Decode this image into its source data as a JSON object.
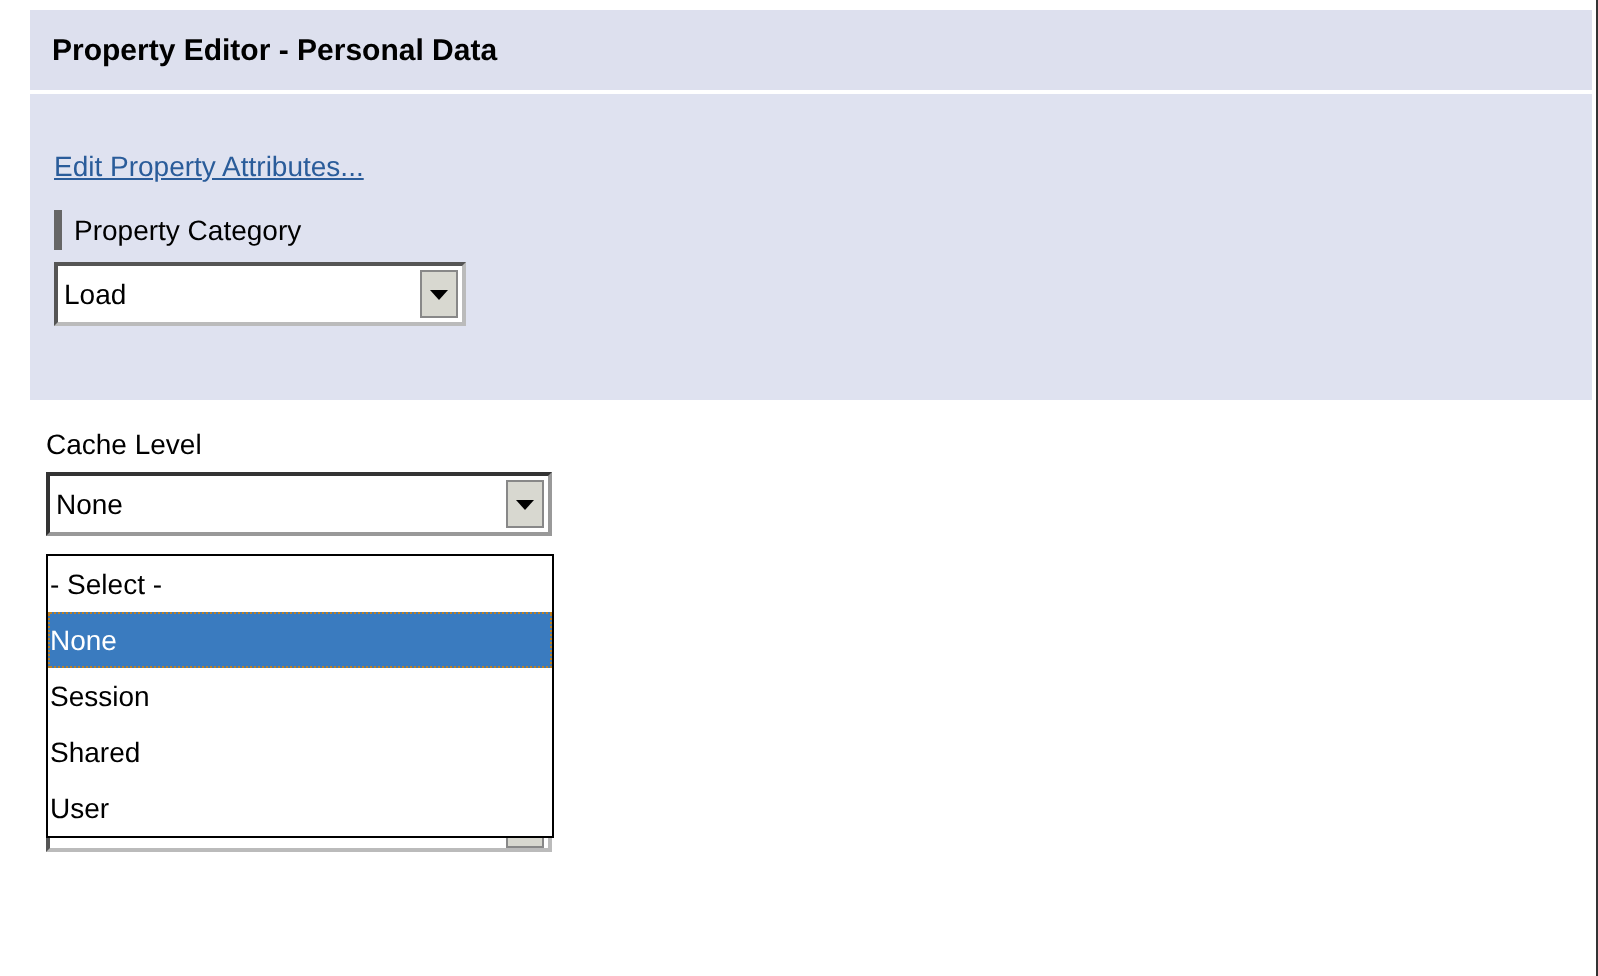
{
  "header": {
    "title": "Property Editor - Personal Data"
  },
  "link": "Edit Property Attributes...",
  "category": {
    "label": "Property Category",
    "value": "Load"
  },
  "cache_level": {
    "label": "Cache Level",
    "value": "None",
    "expanded": true,
    "options": [
      {
        "label": "- Select -",
        "selected": false
      },
      {
        "label": "None",
        "selected": true
      },
      {
        "label": "Session",
        "selected": false
      },
      {
        "label": "Shared",
        "selected": false
      },
      {
        "label": "User",
        "selected": false
      }
    ]
  }
}
